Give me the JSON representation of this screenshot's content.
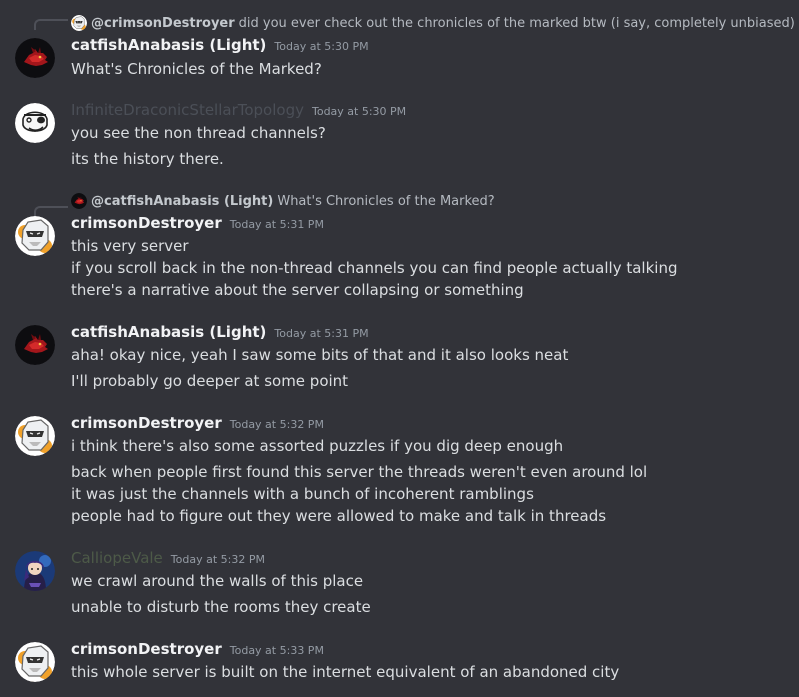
{
  "colors": {
    "background": "#323339",
    "text": "#dbdee1",
    "username": "#f2f3f5",
    "timestamp": "#949ba4",
    "faded_name": "#4b4f57",
    "green_name": "#4d5a48"
  },
  "messages": [
    {
      "reply": {
        "name": "@crimsonDestroyer",
        "text": "did you ever check out the chronicles of the marked btw (i say, completely unbiased)"
      },
      "user": "catfishAnabasis (Light)",
      "time": "Today at 5:30 PM",
      "avatar": "red-dragon",
      "lines": [
        "What's Chronicles of the Marked?"
      ]
    },
    {
      "user": "InfiniteDraconicStellarTopology",
      "time": "Today at 5:30 PM",
      "avatar": "pirate-skull",
      "lines": [
        "you see the non thread channels?",
        "its the history there."
      ]
    },
    {
      "reply": {
        "name": "@catfishAnabasis (Light)",
        "text": "What's Chronicles of the Marked?"
      },
      "user": "crimsonDestroyer",
      "time": "Today at 5:31 PM",
      "avatar": "masked-character",
      "lines": [
        "this very server",
        "if you scroll back in the non-thread channels you can find people actually talking",
        "there's a narrative about the server collapsing or something"
      ]
    },
    {
      "user": "catfishAnabasis (Light)",
      "time": "Today at 5:31 PM",
      "avatar": "red-dragon",
      "lines": [
        "aha! okay nice, yeah I saw some bits of that and it also looks neat",
        "I'll probably go deeper at some point"
      ]
    },
    {
      "user": "crimsonDestroyer",
      "time": "Today at 5:32 PM",
      "avatar": "masked-character",
      "lines": [
        "i think there's also some assorted puzzles if you dig deep enough",
        "back when people first found this server the threads weren't even around lol",
        "it was just the channels with a bunch of incoherent ramblings",
        "people had to figure out they were allowed to make and talk in threads"
      ]
    },
    {
      "user": "CalliopeVale",
      "time": "Today at 5:32 PM",
      "avatar": "anime-portrait",
      "lines": [
        "we crawl around the walls of this place",
        "unable to disturb the rooms they create"
      ]
    },
    {
      "user": "crimsonDestroyer",
      "time": "Today at 5:33 PM",
      "avatar": "masked-character",
      "lines": [
        "this whole server is built on the internet equivalent of an abandoned city"
      ]
    }
  ]
}
